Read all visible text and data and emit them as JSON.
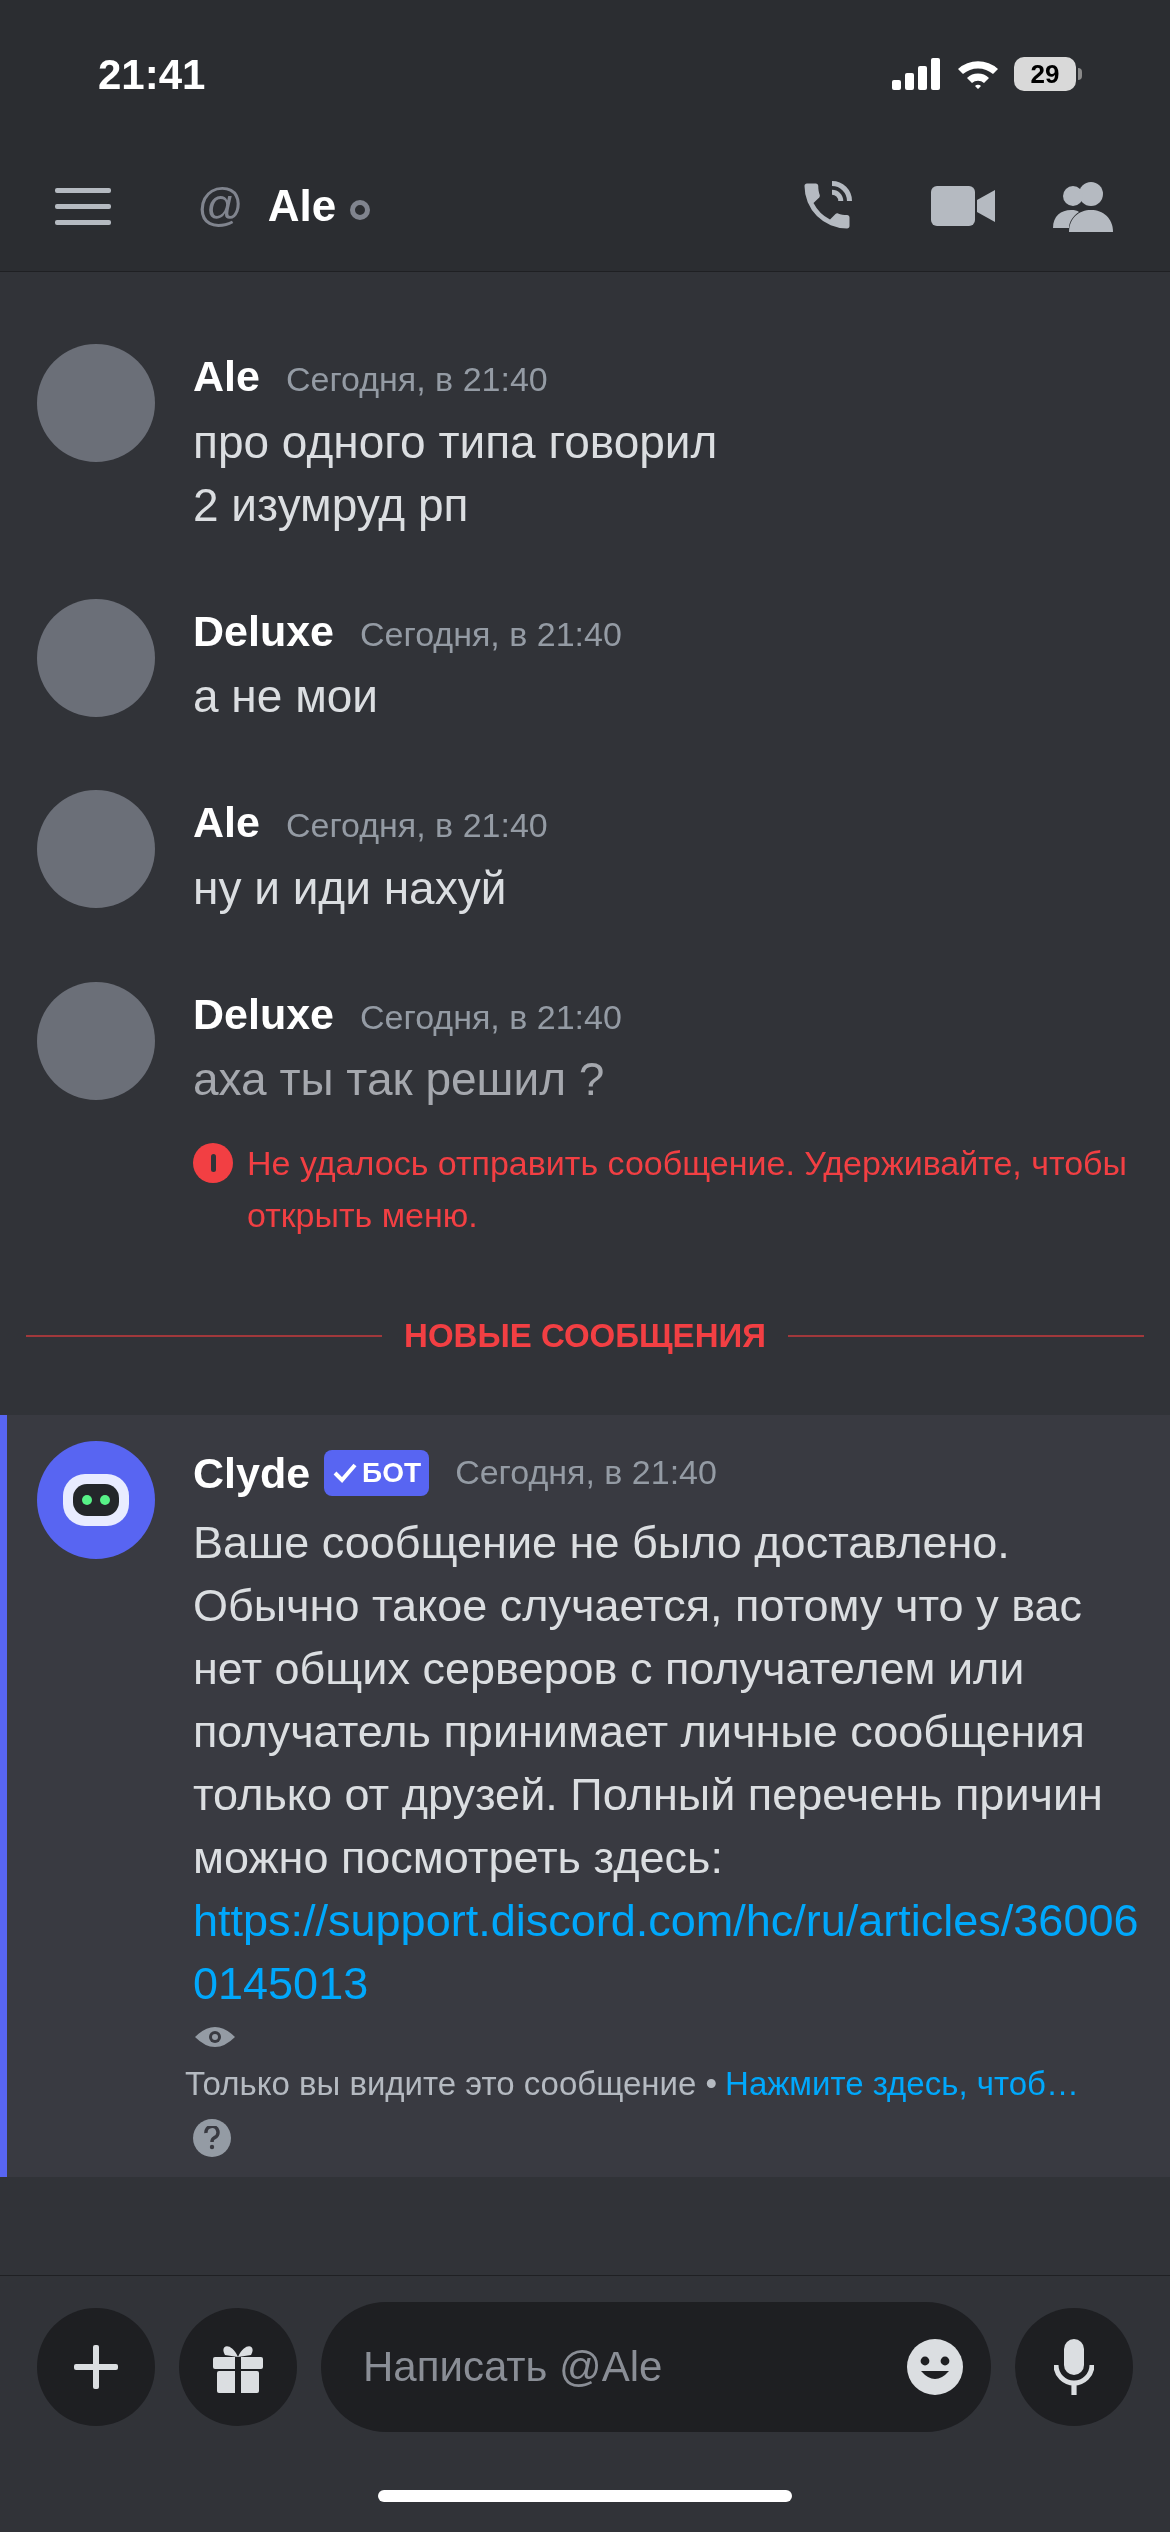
{
  "status_bar": {
    "time": "21:41",
    "battery": "29"
  },
  "header": {
    "at": "@",
    "title": "Ale"
  },
  "messages": [
    {
      "kind": "user",
      "author": "Ale",
      "timestamp": "Сегодня, в 21:40",
      "lines": [
        "про одного типа говорил",
        "2 изумруд рп"
      ]
    },
    {
      "kind": "user",
      "author": "Deluxe",
      "timestamp": "Сегодня, в 21:40",
      "lines": [
        "а не мои"
      ]
    },
    {
      "kind": "user",
      "author": "Ale",
      "timestamp": "Сегодня, в 21:40",
      "lines": [
        "ну и иди нахуй"
      ]
    },
    {
      "kind": "user",
      "author": "Deluxe",
      "timestamp": "Сегодня, в 21:40",
      "lines": [
        "аха ты так решил ?"
      ],
      "error": "Не удалось отправить сообщение. Удерживайте, чтобы открыть меню."
    }
  ],
  "divider": "НОВЫЕ СООБЩЕНИЯ",
  "bot_message": {
    "author": "Clyde",
    "badge": "БОТ",
    "timestamp": "Сегодня, в 21:40",
    "text": "Ваше сообщение не было доставлено. Обычно такое случается, потому что у вас нет общих серверов с получателем или получатель принимает личные сообщения только от друзей. Полный перечень причин можно посмотреть здесь:",
    "link": "https://support.discord.com/hc/ru/articles/360060145013",
    "note": "Только вы видите это сообщение •",
    "note_link": "Нажмите здесь, чтоб…"
  },
  "composer": {
    "placeholder": "Написать @Ale"
  }
}
